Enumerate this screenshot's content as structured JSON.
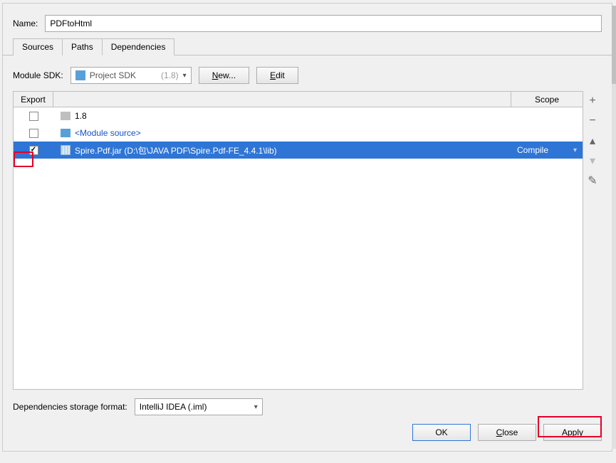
{
  "name_label": "Name:",
  "name_value": "PDFtoHtml",
  "tabs": {
    "sources": "Sources",
    "paths": "Paths",
    "dependencies": "Dependencies"
  },
  "sdk": {
    "label": "Module SDK:",
    "selected": "Project SDK",
    "hint": "(1.8)",
    "new_btn": "New...",
    "edit_btn": "Edit"
  },
  "table": {
    "header_export": "Export",
    "header_scope": "Scope",
    "rows": [
      {
        "icon": "folder",
        "label": "1.8",
        "checked": false,
        "scope": "",
        "selected": false,
        "link": false
      },
      {
        "icon": "folder-blue",
        "label": "<Module source>",
        "checked": false,
        "scope": "",
        "selected": false,
        "link": true
      },
      {
        "icon": "jar",
        "label": "Spire.Pdf.jar (D:\\包\\JAVA PDF\\Spire.Pdf-FE_4.4.1\\lib)",
        "checked": true,
        "scope": "Compile",
        "selected": true,
        "link": false
      }
    ]
  },
  "storage": {
    "label": "Dependencies storage format:",
    "value": "IntelliJ IDEA (.iml)"
  },
  "buttons": {
    "ok": "OK",
    "close": "Close",
    "apply": "Apply"
  }
}
